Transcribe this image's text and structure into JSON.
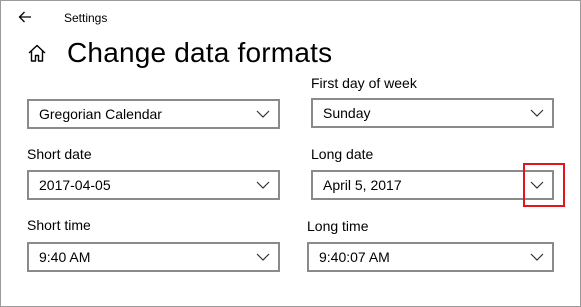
{
  "header": {
    "app_title": "Settings",
    "back_icon": "back-arrow-icon"
  },
  "page": {
    "home_icon": "home-icon",
    "title": "Change data formats"
  },
  "fields": {
    "calendar": {
      "label": "",
      "value": "Gregorian Calendar"
    },
    "first_day_of_week": {
      "label": "First day of week",
      "value": "Sunday"
    },
    "short_date": {
      "label": "Short date",
      "value": "2017-04-05"
    },
    "long_date": {
      "label": "Long date",
      "value": "April 5, 2017"
    },
    "short_time": {
      "label": "Short time",
      "value": "9:40 AM"
    },
    "long_time": {
      "label": "Long time",
      "value": "9:40:07 AM"
    }
  },
  "annotation": {
    "highlight_color": "#e2141d"
  },
  "colors": {
    "border": "#8a8a8a",
    "background": "#ffffff"
  }
}
